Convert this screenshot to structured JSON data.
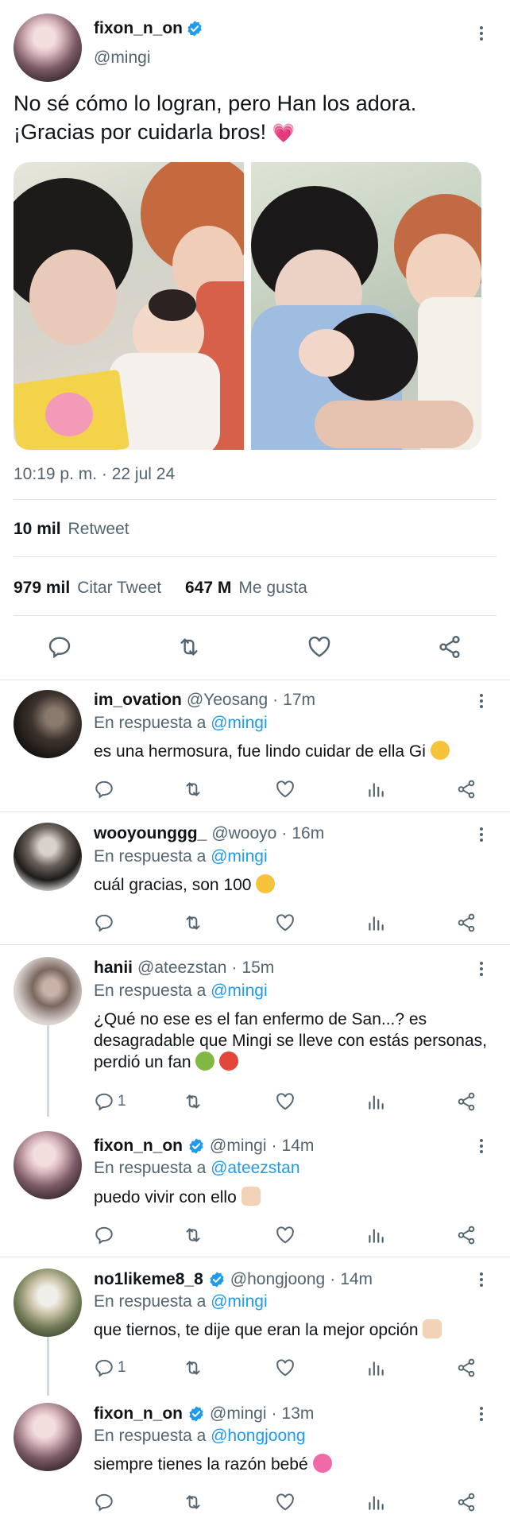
{
  "tweet": {
    "author_name": "fixon_n_on",
    "author_handle": "@mingi",
    "text_line1": "No sé cómo lo logran, pero Han los adora.",
    "text_line2": "¡Gracias por cuidarla bros!",
    "timestamp": "10:19 p. m. · 22 jul 24",
    "retweets_count": "10 mil",
    "retweets_label": "Retweet",
    "quotes_count": "979 mil",
    "quotes_label": "Citar Tweet",
    "likes_count": "647 M",
    "likes_label": "Me gusta"
  },
  "colors": {
    "accent": "#1d9bf0",
    "secondary_text": "#536471",
    "divider": "#e1e5e8"
  },
  "reply_prefix": "En respuesta a",
  "replies": [
    {
      "name": "im_ovation",
      "handle": "@Yeosang",
      "time": "17m",
      "in_reply_to": "@mingi",
      "text": "es una hermosura, fue lindo cuidar de ella Gi",
      "reply_count": ""
    },
    {
      "name": "wooyounggg_",
      "handle": "@wooyo",
      "time": "16m",
      "in_reply_to": "@mingi",
      "text": "cuál gracias, son 100",
      "reply_count": ""
    },
    {
      "name": "hanii",
      "handle": "@ateezstan",
      "time": "15m",
      "in_reply_to": "@mingi",
      "text": "¿Qué no ese es el fan enfermo de San...? es desagradable que Mingi se lleve con estás personas, perdió un fan",
      "reply_count": "1"
    },
    {
      "name": "fixon_n_on",
      "handle": "@mingi",
      "time": "14m",
      "in_reply_to": "@ateezstan",
      "text": "puedo vivir con ello",
      "reply_count": ""
    },
    {
      "name": "no1likeme8_8",
      "handle": "@hongjoong",
      "time": "14m",
      "in_reply_to": "@mingi",
      "text": "que tiernos, te dije que eran la mejor opción",
      "reply_count": "1"
    },
    {
      "name": "fixon_n_on",
      "handle": "@mingi",
      "time": "13m",
      "in_reply_to": "@hongjoong",
      "text": "siempre tienes la razón bebé",
      "reply_count": ""
    }
  ]
}
